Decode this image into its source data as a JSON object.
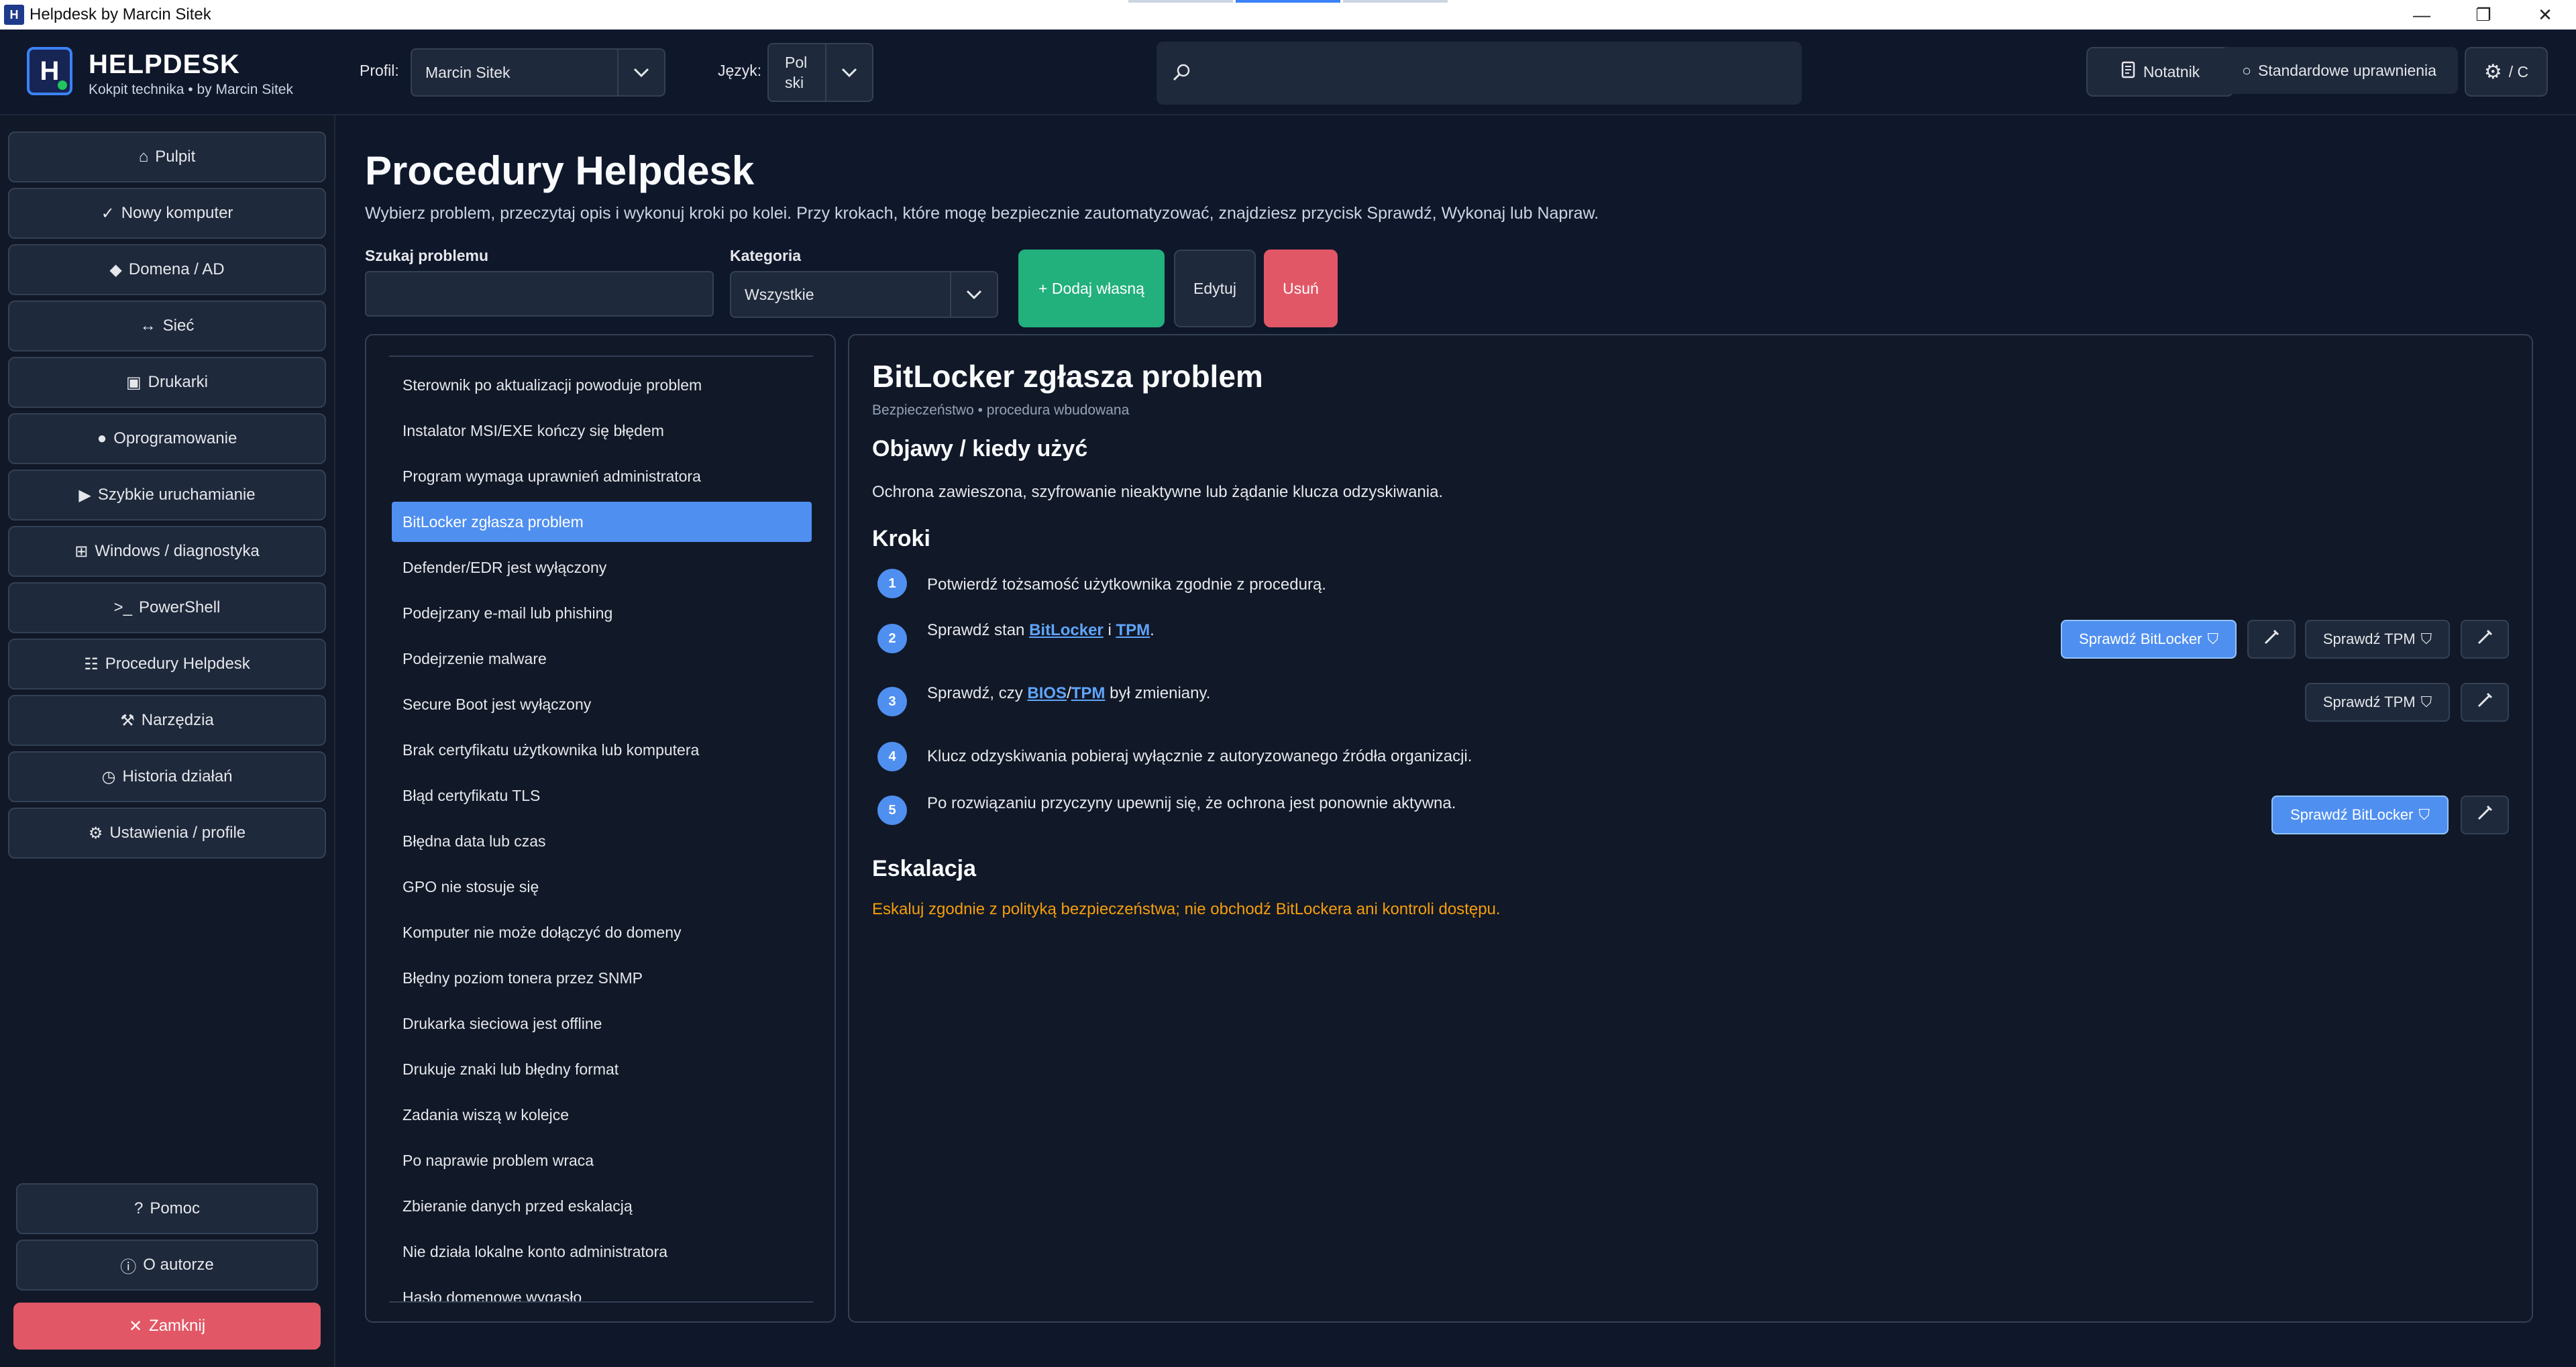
{
  "window": {
    "title": "Helpdesk by Marcin Sitek",
    "icon_text": "H"
  },
  "header": {
    "logo_text": "H",
    "brand_title": "HELPDESK",
    "brand_subtitle": "Kokpit technika • by Marcin Sitek",
    "profile_label": "Profil:",
    "profile_value": "Marcin Sitek",
    "language_label": "Język:",
    "language_value_line1": "Pol",
    "language_value_line2": "ski",
    "search_value": "",
    "notebook_label": "Notatnik",
    "permissions_label": "Standardowe uprawnienia",
    "theme_label": "/ C"
  },
  "sidebar": {
    "items": [
      {
        "icon": "⌂",
        "label": "Pulpit"
      },
      {
        "icon": "✓",
        "label": "Nowy komputer"
      },
      {
        "icon": "◆",
        "label": "Domena / AD"
      },
      {
        "icon": "↔",
        "label": "Sieć"
      },
      {
        "icon": "▣",
        "label": "Drukarki"
      },
      {
        "icon": "●",
        "label": "Oprogramowanie"
      },
      {
        "icon": "▶",
        "label": "Szybkie uruchamianie"
      },
      {
        "icon": "⊞",
        "label": "Windows / diagnostyka"
      },
      {
        "icon": ">_",
        "label": "PowerShell"
      },
      {
        "icon": "☷",
        "label": "Procedury Helpdesk"
      },
      {
        "icon": "⚒",
        "label": "Narzędzia"
      },
      {
        "icon": "◷",
        "label": "Historia działań"
      },
      {
        "icon": "⚙",
        "label": "Ustawienia / profile"
      }
    ],
    "help": {
      "icon": "?",
      "label": "Pomoc"
    },
    "about": {
      "icon": "ⓘ",
      "label": "O autorze"
    },
    "close": {
      "icon": "✕",
      "label": "Zamknij"
    }
  },
  "main": {
    "title": "Procedury Helpdesk",
    "description": "Wybierz problem, przeczytaj opis i wykonuj kroki po kolei. Przy krokach, które mogę bezpiecznie zautomatyzować, znajdziesz przycisk Sprawdź, Wykonaj lub Napraw.",
    "search_label": "Szukaj problemu",
    "search_value": "",
    "category_label": "Kategoria",
    "category_value": "Wszystkie",
    "add_label": "+ Dodaj własną",
    "edit_label": "Edytuj",
    "delete_label": "Usuń"
  },
  "procedures": [
    "Sterownik po aktualizacji powoduje problem",
    "Instalator MSI/EXE kończy się błędem",
    "Program wymaga uprawnień administratora",
    "BitLocker zgłasza problem",
    "Defender/EDR jest wyłączony",
    "Podejrzany e-mail lub phishing",
    "Podejrzenie malware",
    "Secure Boot jest wyłączony",
    "Brak certyfikatu użytkownika lub komputera",
    "Błąd certyfikatu TLS",
    "Błędna data lub czas",
    "GPO nie stosuje się",
    "Komputer nie może dołączyć do domeny",
    "Błędny poziom tonera przez SNMP",
    "Drukarka sieciowa jest offline",
    "Drukuje znaki lub błędny format",
    "Zadania wiszą w kolejce",
    "Po naprawie problem wraca",
    "Zbieranie danych przed eskalacją",
    "Nie działa lokalne konto administratora",
    "Hasło domenowe wygasło"
  ],
  "selected_index": 3,
  "detail": {
    "title": "BitLocker zgłasza problem",
    "subtitle": "Bezpieczeństwo • procedura wbudowana",
    "symptoms_heading": "Objawy / kiedy użyć",
    "symptoms_text": "Ochrona zawieszona, szyfrowanie nieaktywne lub żądanie klucza odzyskiwania.",
    "steps_heading": "Kroki",
    "steps": [
      {
        "num": "1",
        "text": "Potwierdź tożsamość użytkownika zgodnie z procedurą."
      },
      {
        "num": "2",
        "pre": "Sprawdź stan ",
        "link1": "BitLocker",
        "mid": " i ",
        "link2": "TPM",
        "post": "."
      },
      {
        "num": "3",
        "pre": "Sprawdź, czy ",
        "link1": "BIOS",
        "mid": "/",
        "link2": "TPM",
        "post": " był zmieniany."
      },
      {
        "num": "4",
        "text": "Klucz odzyskiwania pobieraj wyłącznie z autoryzowanego źródła organizacji."
      },
      {
        "num": "5",
        "text": "Po rozwiązaniu przyczyny upewnij się, że ochrona jest ponownie aktywna."
      }
    ],
    "btn_check_bitlocker": "Sprawdź BitLocker",
    "btn_check_tpm": "Sprawdź TPM",
    "escalation_heading": "Eskalacja",
    "escalation_text": "Eskaluj zgodnie z polityką bezpieczeństwa; nie obchodź BitLockera ani kontroli dostępu."
  },
  "colors": {
    "accent": "#4f8ff0",
    "success": "#22b07d",
    "danger": "#e25766",
    "warning": "#f59e0b",
    "background": "#0f172a"
  }
}
